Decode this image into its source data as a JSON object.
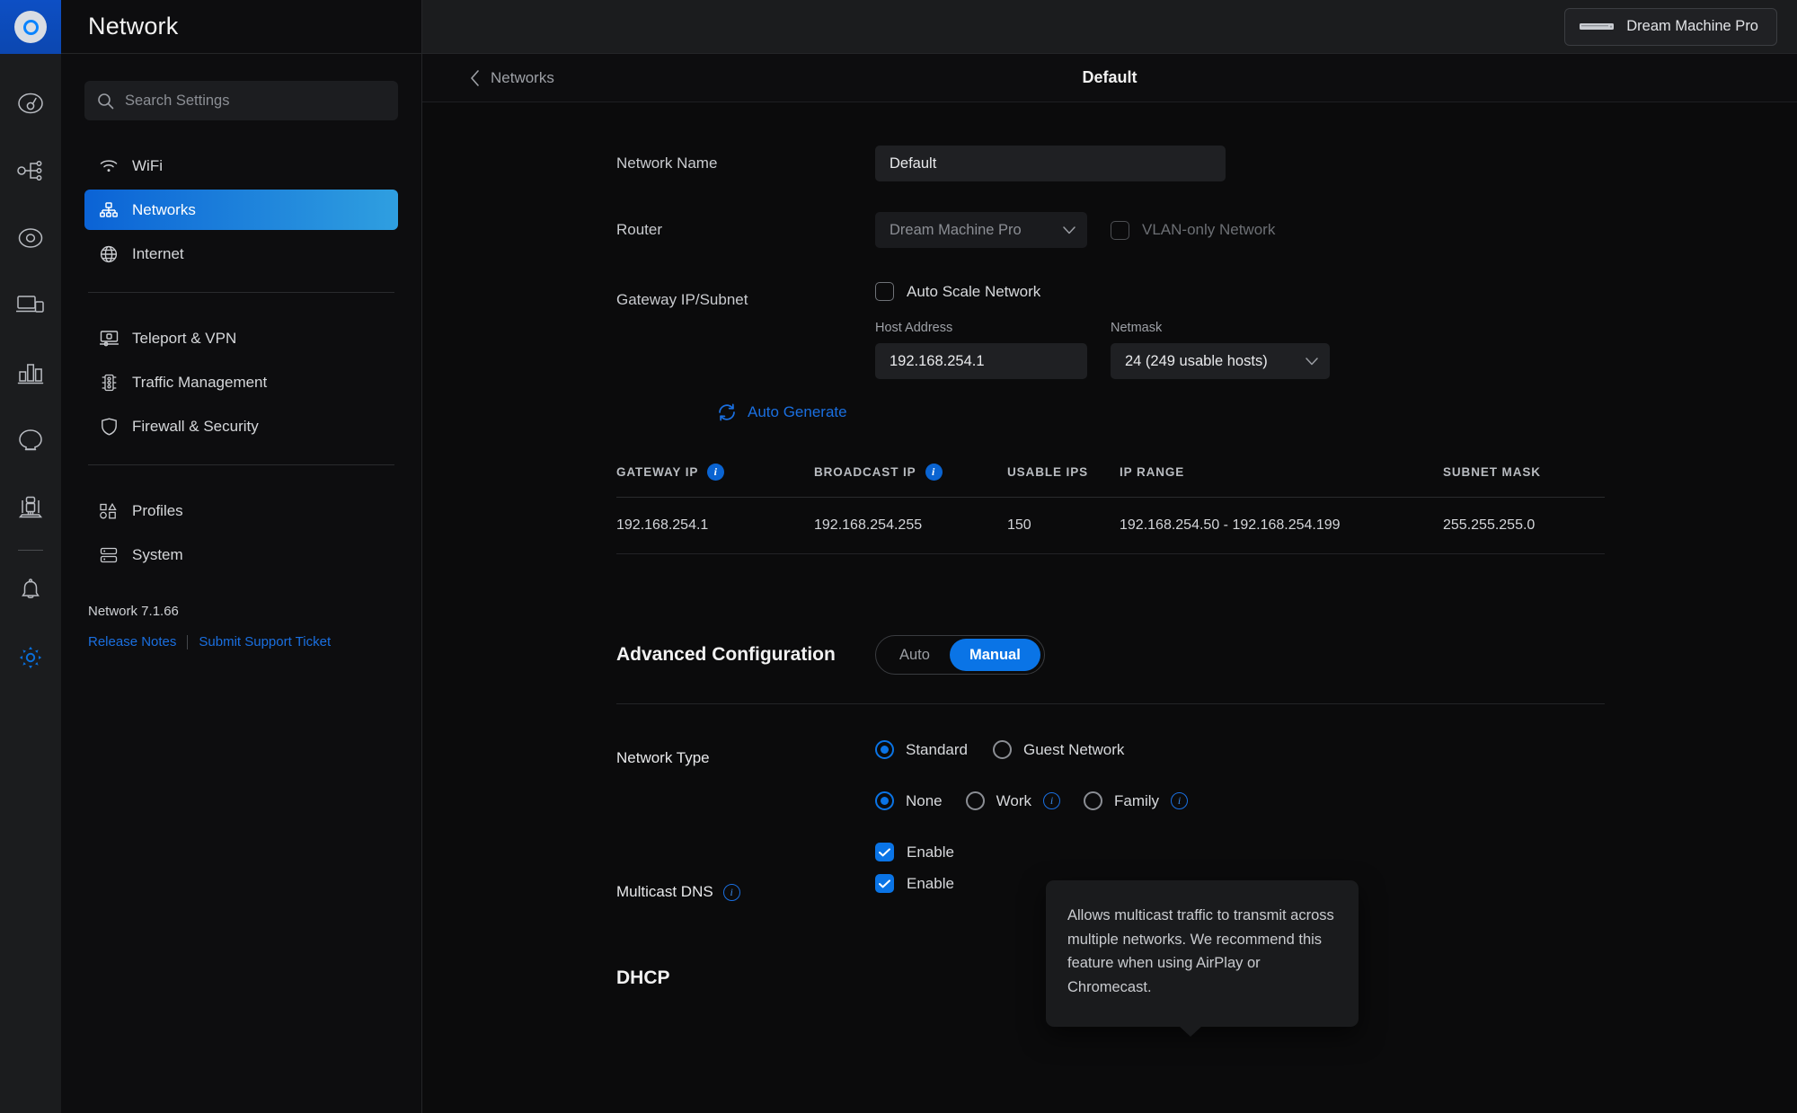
{
  "rail": {
    "logo_name": "unifi-logo",
    "items": [
      {
        "name": "dashboard-gauge-icon"
      },
      {
        "name": "topology-icon"
      },
      {
        "name": "devices-circle-icon"
      },
      {
        "name": "client-devices-icon"
      },
      {
        "name": "statistics-icon"
      },
      {
        "name": "chat-bubble-icon"
      },
      {
        "name": "insights-icon"
      }
    ],
    "bottom": [
      {
        "name": "notifications-bell-icon"
      },
      {
        "name": "settings-gear-icon"
      }
    ]
  },
  "sidebar": {
    "title": "Network",
    "search": {
      "placeholder": "Search Settings"
    },
    "group1": [
      {
        "label": "WiFi",
        "icon": "wifi-icon",
        "active": false
      },
      {
        "label": "Networks",
        "icon": "networks-icon",
        "active": true
      },
      {
        "label": "Internet",
        "icon": "globe-icon",
        "active": false
      }
    ],
    "group2": [
      {
        "label": "Teleport & VPN",
        "icon": "teleport-vpn-icon"
      },
      {
        "label": "Traffic Management",
        "icon": "traffic-light-icon"
      },
      {
        "label": "Firewall & Security",
        "icon": "shield-icon"
      }
    ],
    "group3": [
      {
        "label": "Profiles",
        "icon": "profiles-icon"
      },
      {
        "label": "System",
        "icon": "system-icon"
      }
    ],
    "version": "Network 7.1.66",
    "links": {
      "release_notes": "Release Notes",
      "support_ticket": "Submit Support Ticket"
    }
  },
  "topbar": {
    "device": "Dream Machine Pro"
  },
  "subheader": {
    "back_label": "Networks",
    "title": "Default"
  },
  "form": {
    "network_name_label": "Network Name",
    "network_name_value": "Default",
    "router_label": "Router",
    "router_value": "Dream Machine Pro",
    "vlan_only_label": "VLAN-only Network",
    "gateway_label": "Gateway IP/Subnet",
    "auto_scale_label": "Auto Scale Network",
    "host_address_caption": "Host Address",
    "host_address_value": "192.168.254.1",
    "netmask_caption": "Netmask",
    "netmask_value": "24 (249 usable hosts)",
    "auto_generate_label": "Auto Generate"
  },
  "table": {
    "headers": [
      "GATEWAY IP",
      "BROADCAST IP",
      "USABLE IPS",
      "IP RANGE",
      "SUBNET MASK"
    ],
    "row": [
      "192.168.254.1",
      "192.168.254.255",
      "150",
      "192.168.254.50 - 192.168.254.199",
      "255.255.255.0"
    ]
  },
  "advanced": {
    "title": "Advanced Configuration",
    "options": [
      "Auto",
      "Manual"
    ],
    "selected": "Manual"
  },
  "network_type": {
    "label": "Network Type",
    "options": [
      "Standard",
      "Guest Network"
    ],
    "selected": "Standard"
  },
  "content_filter": {
    "options": [
      "None",
      "Work",
      "Family"
    ],
    "selected": "None"
  },
  "igmp": {
    "enable_label": "Enable",
    "checked": true
  },
  "multicast_dns": {
    "label": "Multicast DNS",
    "enable_label": "Enable",
    "checked": true
  },
  "tooltip": {
    "text": "Allows multicast traffic to transmit across multiple networks. We recommend this feature when using AirPlay or Chromecast."
  },
  "dhcp": {
    "title": "DHCP"
  },
  "colors": {
    "accent": "#0a74e6",
    "link": "#1a6fe0",
    "sidebar_active_start": "#0b63d6",
    "sidebar_active_end": "#2f9fe0"
  }
}
